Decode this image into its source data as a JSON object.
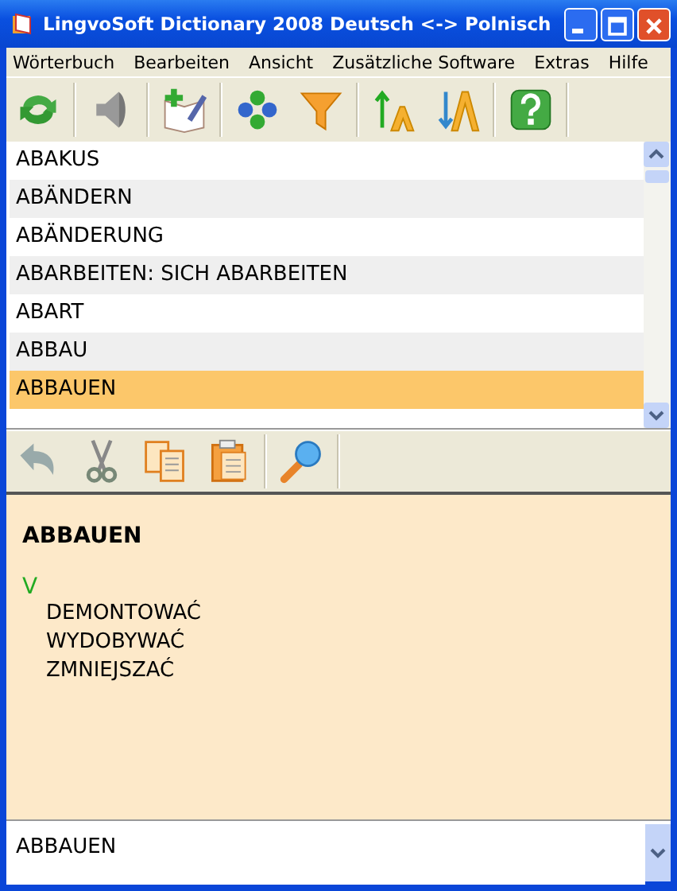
{
  "window": {
    "title": "LingvoSoft Dictionary 2008 Deutsch <-> Polnisch"
  },
  "menu": [
    "Wörterbuch",
    "Bearbeiten",
    "Ansicht",
    "Zusätzliche Software",
    "Extras",
    "Hilfe"
  ],
  "word_list": [
    {
      "word": "ABAKUS",
      "selected": false
    },
    {
      "word": "ABÄNDERN",
      "selected": false
    },
    {
      "word": "ABÄNDERUNG",
      "selected": false
    },
    {
      "word": "ABARBEITEN: SICH ABARBEITEN",
      "selected": false
    },
    {
      "word": "ABART",
      "selected": false
    },
    {
      "word": "ABBAU",
      "selected": false
    },
    {
      "word": "ABBAUEN",
      "selected": true
    }
  ],
  "entry": {
    "headword": "ABBAUEN",
    "part_of_speech": "V",
    "translations": [
      "DEMONTOWAĆ",
      "WYDOBYWAĆ",
      "ZMNIEJSZAĆ"
    ]
  },
  "search": {
    "value": "ABBAUEN"
  }
}
